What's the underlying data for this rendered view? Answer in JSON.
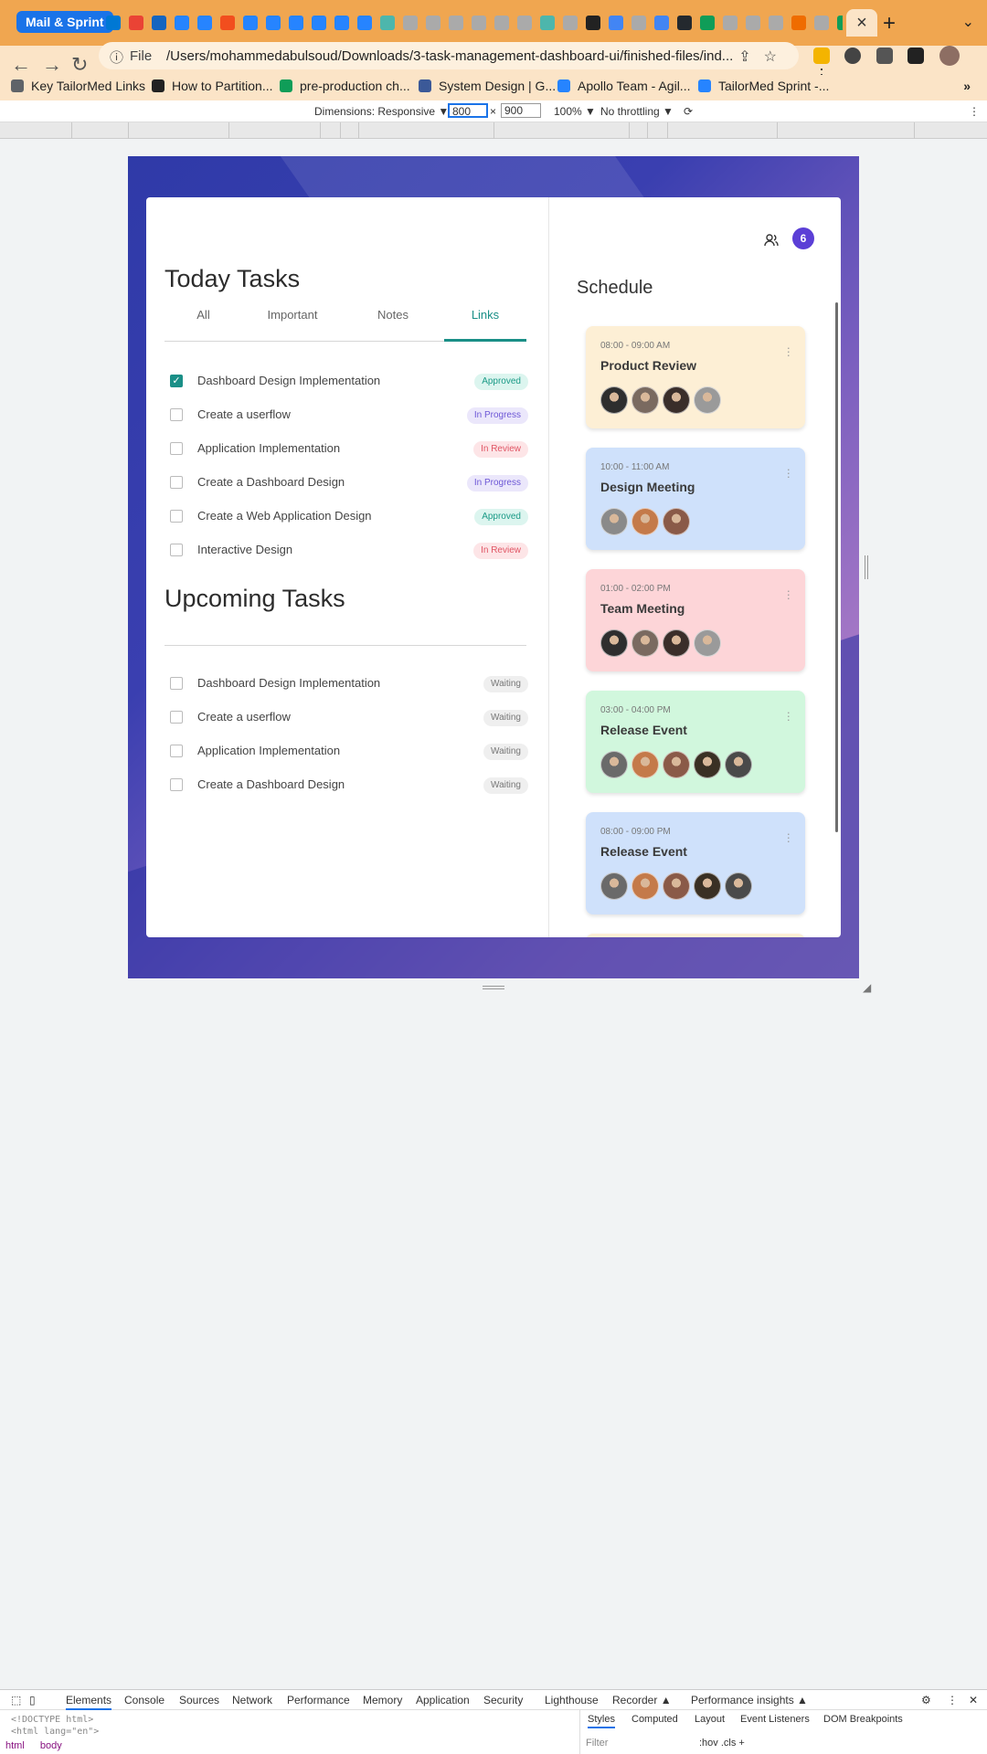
{
  "browser": {
    "tab_group_label": "Mail & Sprint",
    "address": {
      "scheme_label": "File",
      "url": "/Users/mohammedabulsoud/Downloads/3-task-management-dashboard-ui/finished-files/ind..."
    },
    "bookmarks": [
      {
        "label": "Key TailorMed Links",
        "icon": "folder-icon",
        "color": "#5f6368"
      },
      {
        "label": "How to Partition...",
        "icon": "site-icon",
        "color": "#222222"
      },
      {
        "label": "pre-production ch...",
        "icon": "sheets-icon",
        "color": "#0f9d58"
      },
      {
        "label": "System Design | G...",
        "icon": "site-icon",
        "color": "#3b5998"
      },
      {
        "label": "Apollo Team - Agil...",
        "icon": "jira-icon",
        "color": "#2684ff"
      },
      {
        "label": "TailorMed Sprint -...",
        "icon": "jira-icon",
        "color": "#2684ff"
      }
    ],
    "bookmarks_more": "»",
    "tab_favicon_colors": [
      "#0078d4",
      "#ea4335",
      "#1565c0",
      "#2684ff",
      "#2684ff",
      "#f24e1e",
      "#2684ff",
      "#2684ff",
      "#2684ff",
      "#2684ff",
      "#2684ff",
      "#2684ff",
      "#4db6ac",
      "#aaaaaa",
      "#aaaaaa",
      "#aaaaaa",
      "#aaaaaa",
      "#aaaaaa",
      "#aaaaaa",
      "#4db6ac",
      "#aaaaaa",
      "#222222",
      "#4285f4",
      "#aaaaaa",
      "#4285f4",
      "#24292e",
      "#0f9d58",
      "#aaaaaa",
      "#aaaaaa",
      "#aaaaaa",
      "#ef6c00",
      "#aaaaaa",
      "#0f9d58",
      "#222222",
      "#222222",
      "#222222",
      "#4285f4",
      "#aaaaaa"
    ]
  },
  "devtools": {
    "dimensions_label": "Dimensions: Responsive ▼",
    "width": "800",
    "times": "×",
    "height": "900",
    "zoom": "100% ▼",
    "throttling": "No throttling ▼",
    "tabs": [
      "Elements",
      "Console",
      "Sources",
      "Network",
      "Performance",
      "Memory",
      "Application",
      "Security",
      "Lighthouse",
      "Recorder ▲",
      "Performance insights ▲"
    ],
    "code_line1": "<!DOCTYPE html>",
    "code_line2": "<html lang=\"en\">",
    "breadcrumb_html": "html",
    "breadcrumb_body": "body",
    "styles_tabs": [
      "Styles",
      "Computed",
      "Layout",
      "Event Listeners",
      "DOM Breakpoints"
    ],
    "filter_placeholder": "Filter",
    "filter_tools": ":hov  .cls  +"
  },
  "app": {
    "today": {
      "title": "Today Tasks",
      "tabs": [
        {
          "label": "All",
          "active": false
        },
        {
          "label": "Important",
          "active": false
        },
        {
          "label": "Notes",
          "active": false
        },
        {
          "label": "Links",
          "active": true
        }
      ],
      "tasks": [
        {
          "label": "Dashboard Design Implementation",
          "checked": true,
          "status": "Approved"
        },
        {
          "label": "Create a userflow",
          "checked": false,
          "status": "In Progress"
        },
        {
          "label": "Application Implementation",
          "checked": false,
          "status": "In Review"
        },
        {
          "label": "Create a Dashboard Design",
          "checked": false,
          "status": "In Progress"
        },
        {
          "label": "Create a Web Application Design",
          "checked": false,
          "status": "Approved"
        },
        {
          "label": "Interactive Design",
          "checked": false,
          "status": "In Review"
        }
      ]
    },
    "upcoming": {
      "title": "Upcoming Tasks",
      "tasks": [
        {
          "label": "Dashboard Design Implementation",
          "checked": false,
          "status": "Waiting"
        },
        {
          "label": "Create a userflow",
          "checked": false,
          "status": "Waiting"
        },
        {
          "label": "Application Implementation",
          "checked": false,
          "status": "Waiting"
        },
        {
          "label": "Create a Dashboard Design",
          "checked": false,
          "status": "Waiting"
        }
      ]
    },
    "header": {
      "notification_count": "6",
      "notification_color": "#5b3fd6"
    },
    "schedule": {
      "title": "Schedule",
      "events": [
        {
          "time": "08:00 - 09:00 AM",
          "title": "Product Review",
          "bg": "#fdefd5",
          "avatars": [
            "#2e2e2e",
            "#7a6a60",
            "#3a2e2a",
            "#9a9a9a"
          ]
        },
        {
          "time": "10:00 - 11:00 AM",
          "title": "Design Meeting",
          "bg": "#cfe1fb",
          "avatars": [
            "#8a8a8a",
            "#c47a4a",
            "#8a5a48"
          ]
        },
        {
          "time": "01:00 - 02:00 PM",
          "title": "Team Meeting",
          "bg": "#fdd5d8",
          "avatars": [
            "#2e2e2e",
            "#7a6a60",
            "#3a2e2a",
            "#9a9a9a"
          ]
        },
        {
          "time": "03:00 - 04:00 PM",
          "title": "Release Event",
          "bg": "#d1f7dd",
          "avatars": [
            "#6a6a6a",
            "#c47a4a",
            "#8a5a48",
            "#3a3024",
            "#4a4a4a"
          ]
        },
        {
          "time": "08:00 - 09:00 PM",
          "title": "Release Event",
          "bg": "#cfe1fb",
          "avatars": [
            "#6a6a6a",
            "#c47a4a",
            "#8a5a48",
            "#3a3024",
            "#4a4a4a"
          ]
        }
      ]
    },
    "status_styles": {
      "Approved": "approved",
      "In Progress": "progress",
      "In Review": "review",
      "Waiting": "waiting"
    }
  }
}
